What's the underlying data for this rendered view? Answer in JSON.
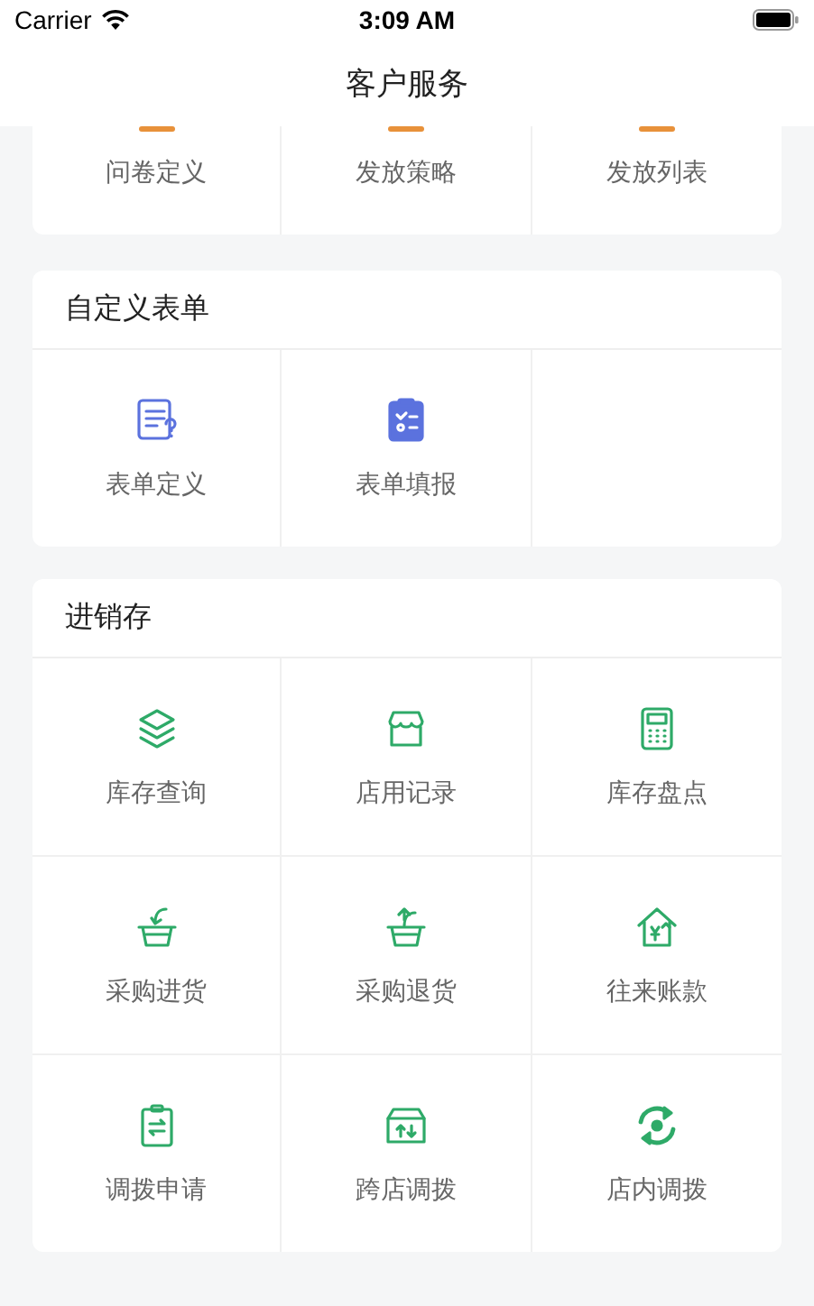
{
  "status_bar": {
    "carrier": "Carrier",
    "time": "3:09 AM"
  },
  "nav": {
    "title": "客户服务"
  },
  "sections": [
    {
      "color": "#e8913a",
      "items": [
        {
          "label": "问卷定义"
        },
        {
          "label": "发放策略"
        },
        {
          "label": "发放列表"
        }
      ]
    },
    {
      "title": "自定义表单",
      "color": "#5b72de",
      "items": [
        {
          "label": "表单定义"
        },
        {
          "label": "表单填报"
        }
      ]
    },
    {
      "title": "进销存",
      "color": "#2eaa68",
      "items": [
        {
          "label": "库存查询"
        },
        {
          "label": "店用记录"
        },
        {
          "label": "库存盘点"
        },
        {
          "label": "采购进货"
        },
        {
          "label": "采购退货"
        },
        {
          "label": "往来账款"
        },
        {
          "label": "调拨申请"
        },
        {
          "label": "跨店调拨"
        },
        {
          "label": "店内调拨"
        }
      ]
    }
  ]
}
